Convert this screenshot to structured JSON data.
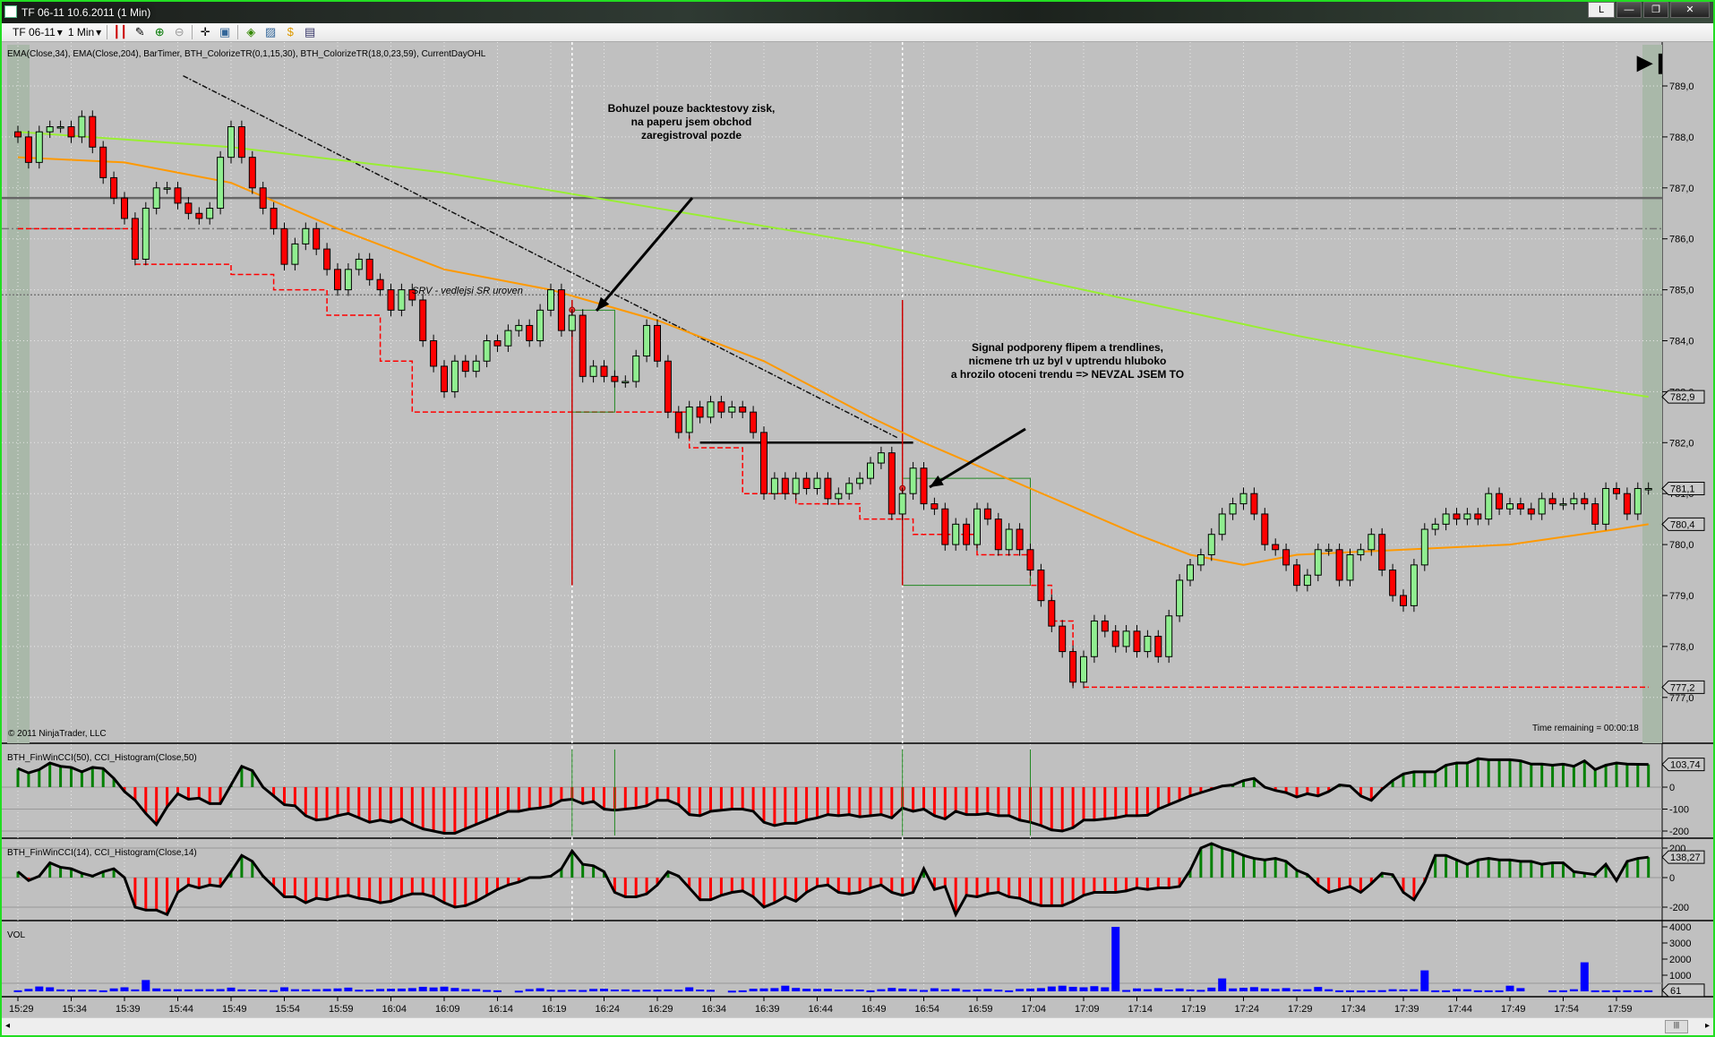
{
  "window": {
    "title": "TF 06-11  10.6.2011 (1 Min)",
    "btn_l": "L",
    "btn_min": "—",
    "btn_max": "❐",
    "btn_close": "✕"
  },
  "toolbar": {
    "instrument": "TF 06-11",
    "interval": "1 Min"
  },
  "main_panel": {
    "indicators_label": "EMA(Close,34), EMA(Close,204), BarTimer, BTH_ColorizeTR(0,1,15,30), BTH_ColorizeTR(18,0,23,59), CurrentDayOHL",
    "copyright": "© 2011 NinjaTrader, LLC",
    "time_remaining": "Time remaining = 00:00:18",
    "srv_label": "SRV - vedlejsi SR uroven",
    "note1": [
      "Bohuzel pouze backtestovy zisk,",
      "na paperu jsem obchod",
      "zaregistroval pozde"
    ],
    "note2": [
      "Signal podporeny flipem a trendlines,",
      "nicmene trh uz byl v uptrendu hluboko",
      "a hrozilo otoceni trendu => NEVZAL JSEM TO"
    ],
    "price_ticks": [
      "789,0",
      "788,0",
      "787,0",
      "786,0",
      "785,0",
      "784,0",
      "783,0",
      "782,0",
      "781,0",
      "780,0",
      "779,0",
      "778,0",
      "777,0"
    ],
    "markers": [
      {
        "label": "782,9",
        "value": 782.9
      },
      {
        "label": "781,1",
        "value": 781.1
      },
      {
        "label": "780,4",
        "value": 780.4
      },
      {
        "label": "777,2",
        "value": 777.2
      }
    ]
  },
  "cci50_panel": {
    "label": "BTH_FinWinCCI(50), CCI_Histogram(Close,50)",
    "ticks": [
      "0",
      "-100",
      "-200"
    ],
    "marker": "103,74"
  },
  "cci14_panel": {
    "label": "BTH_FinWinCCI(14), CCI_Histogram(Close,14)",
    "ticks": [
      "200",
      "0",
      "-200"
    ],
    "marker": "138,27"
  },
  "vol_panel": {
    "label": "VOL",
    "ticks": [
      "4000",
      "3000",
      "2000",
      "1000"
    ],
    "marker": "61"
  },
  "colors": {
    "bg": "#c0c0c0",
    "up": "#90ee90",
    "down": "#ff0000",
    "ema34": "#ff9900",
    "ema204": "#99ee33",
    "hist_up": "#008000",
    "hist_down": "#ff0000",
    "vol": "#0000ff"
  },
  "chart_data": {
    "type": "candlestick",
    "start_time": "15:29",
    "interval_min": 1,
    "time_labels": [
      "15:29",
      "15:34",
      "15:39",
      "15:44",
      "15:49",
      "15:54",
      "15:59",
      "16:04",
      "16:09",
      "16:14",
      "16:19",
      "16:24",
      "16:29",
      "16:34",
      "16:39",
      "16:44",
      "16:49",
      "16:54",
      "16:59",
      "17:04",
      "17:09",
      "17:14",
      "17:19",
      "17:24",
      "17:29",
      "17:34",
      "17:39",
      "17:44",
      "17:49",
      "17:54",
      "17:59"
    ],
    "ylim": [
      776.8,
      789.5
    ],
    "close": [
      788.0,
      787.5,
      788.1,
      788.2,
      788.2,
      788.0,
      788.4,
      787.8,
      787.2,
      786.8,
      786.4,
      785.6,
      786.6,
      787.0,
      787.0,
      786.7,
      786.5,
      786.4,
      786.6,
      787.6,
      788.2,
      787.6,
      787.0,
      786.6,
      786.2,
      785.5,
      785.9,
      786.2,
      785.8,
      785.4,
      785.0,
      785.4,
      785.6,
      785.2,
      785.0,
      784.6,
      785.0,
      784.8,
      784.0,
      783.5,
      783.0,
      783.6,
      783.4,
      783.6,
      784.0,
      783.9,
      784.2,
      784.3,
      784.0,
      784.6,
      785.0,
      784.2,
      784.5,
      783.3,
      783.5,
      783.3,
      783.2,
      783.2,
      783.7,
      784.3,
      783.6,
      782.6,
      782.2,
      782.7,
      782.5,
      782.8,
      782.6,
      782.7,
      782.6,
      782.2,
      781.0,
      781.3,
      781.0,
      781.3,
      781.1,
      781.3,
      780.9,
      781.0,
      781.2,
      781.3,
      781.6,
      781.8,
      780.6,
      781.0,
      781.5,
      780.8,
      780.7,
      780.0,
      780.4,
      780.0,
      780.7,
      780.5,
      779.9,
      780.3,
      779.9,
      779.5,
      778.9,
      778.4,
      777.9,
      777.3,
      777.8,
      778.5,
      778.3,
      778.0,
      778.3,
      777.9,
      778.2,
      777.8,
      778.6,
      779.3,
      779.6,
      779.8,
      780.2,
      780.6,
      780.8,
      781.0,
      780.6,
      780.0,
      779.9,
      779.6,
      779.2,
      779.4,
      779.9,
      779.9,
      779.3,
      779.8,
      779.9,
      780.2,
      779.5,
      779.0,
      778.8,
      779.6,
      780.3,
      780.4,
      780.6,
      780.5,
      780.6,
      780.5,
      781.0,
      780.7,
      780.8,
      780.7,
      780.6,
      780.9,
      780.8,
      780.8,
      780.9,
      780.8,
      780.4,
      781.1,
      781.0,
      780.6,
      781.1,
      781.1
    ],
    "ema34": [
      [
        0,
        787.6
      ],
      [
        10,
        787.5
      ],
      [
        20,
        787.1
      ],
      [
        30,
        786.2
      ],
      [
        40,
        785.4
      ],
      [
        50,
        785.0
      ],
      [
        60,
        784.4
      ],
      [
        70,
        783.6
      ],
      [
        80,
        782.5
      ],
      [
        85,
        782.0
      ],
      [
        95,
        781.1
      ],
      [
        105,
        780.2
      ],
      [
        110,
        779.8
      ],
      [
        115,
        779.6
      ],
      [
        120,
        779.8
      ],
      [
        140,
        780.0
      ],
      [
        150,
        780.3
      ],
      [
        153,
        780.4
      ]
    ],
    "ema204": [
      [
        0,
        788.1
      ],
      [
        20,
        787.8
      ],
      [
        40,
        787.3
      ],
      [
        60,
        786.6
      ],
      [
        80,
        785.9
      ],
      [
        100,
        785.0
      ],
      [
        120,
        784.1
      ],
      [
        140,
        783.3
      ],
      [
        153,
        782.9
      ]
    ],
    "levels": [
      {
        "price": 786.8,
        "style": "solid-gray"
      },
      {
        "price": 786.2,
        "style": "dashdot-gray"
      },
      {
        "price": 784.9,
        "style": "dotted-gray"
      },
      {
        "price": 786.2,
        "from": 0,
        "to": 11,
        "style": "dashed-red"
      },
      {
        "price": 777.2,
        "from": 100,
        "to": 153,
        "style": "dashed-red"
      },
      {
        "price": 782.0,
        "from": 64,
        "to": 84,
        "style": "solid-black"
      }
    ],
    "trendline": [
      [
        15.5,
        789.2
      ],
      [
        82.5,
        782.1
      ]
    ],
    "trail_stop": [
      [
        11,
        785.5
      ],
      [
        20,
        785.5
      ],
      [
        20,
        785.3
      ],
      [
        24,
        785.3
      ],
      [
        24,
        785.0
      ],
      [
        29,
        785.0
      ],
      [
        29,
        784.5
      ],
      [
        34,
        784.5
      ],
      [
        34,
        783.6
      ],
      [
        37,
        783.6
      ],
      [
        37,
        782.6
      ],
      [
        63,
        782.6
      ],
      [
        63,
        781.9
      ],
      [
        68,
        781.9
      ],
      [
        68,
        781.0
      ],
      [
        73,
        781.0
      ],
      [
        73,
        780.8
      ],
      [
        79,
        780.8
      ],
      [
        79,
        780.5
      ],
      [
        84,
        780.5
      ],
      [
        84,
        780.2
      ],
      [
        90,
        780.2
      ],
      [
        90,
        779.8
      ],
      [
        95,
        779.8
      ],
      [
        95,
        779.2
      ],
      [
        97,
        779.2
      ],
      [
        97,
        778.5
      ],
      [
        99,
        778.5
      ],
      [
        99,
        777.2
      ]
    ],
    "boxes": [
      [
        52,
        56,
        784.6,
        782.6
      ],
      [
        83,
        95,
        781.3,
        779.2
      ]
    ],
    "signal_lines": [
      52,
      83
    ],
    "cci50": [
      85,
      65,
      80,
      110,
      95,
      90,
      70,
      90,
      85,
      40,
      -20,
      -60,
      -120,
      -170,
      -90,
      -30,
      -55,
      -50,
      -75,
      -75,
      10,
      95,
      75,
      0,
      -40,
      -80,
      -85,
      -130,
      -150,
      -145,
      -130,
      -120,
      -140,
      -160,
      -150,
      -160,
      -145,
      -170,
      -190,
      -200,
      -210,
      -210,
      -190,
      -170,
      -150,
      -130,
      -110,
      -110,
      -100,
      -95,
      -85,
      -60,
      -55,
      -75,
      -65,
      -100,
      -105,
      -100,
      -95,
      -85,
      -60,
      -60,
      -80,
      -125,
      -130,
      -110,
      -105,
      -100,
      -100,
      -110,
      -160,
      -175,
      -165,
      -165,
      -150,
      -140,
      -125,
      -130,
      -125,
      -135,
      -130,
      -125,
      -140,
      -95,
      -110,
      -100,
      -130,
      -145,
      -110,
      -125,
      -125,
      -120,
      -130,
      -130,
      -150,
      -160,
      -175,
      -195,
      -200,
      -185,
      -150,
      -150,
      -145,
      -140,
      -130,
      -130,
      -128,
      -100,
      -80,
      -60,
      -40,
      -25,
      -10,
      5,
      10,
      30,
      40,
      0,
      -15,
      -25,
      -45,
      -30,
      -40,
      -20,
      10,
      5,
      -40,
      -60,
      -10,
      30,
      60,
      70,
      70,
      70,
      100,
      110,
      110,
      130,
      125,
      125,
      125,
      120,
      105,
      105,
      100,
      105,
      95,
      120,
      80,
      100,
      110,
      105,
      104,
      103.74
    ],
    "cci14": [
      40,
      -20,
      10,
      100,
      70,
      60,
      30,
      10,
      40,
      60,
      0,
      -200,
      -220,
      -220,
      -250,
      -100,
      -50,
      -70,
      -50,
      -60,
      40,
      150,
      110,
      10,
      -60,
      -130,
      -130,
      -170,
      -140,
      -150,
      -130,
      -120,
      -140,
      -150,
      -170,
      -160,
      -130,
      -110,
      -110,
      -130,
      -170,
      -200,
      -190,
      -160,
      -120,
      -80,
      -50,
      -30,
      0,
      0,
      10,
      60,
      180,
      90,
      80,
      40,
      -100,
      -130,
      -130,
      -110,
      -50,
      40,
      10,
      -70,
      -150,
      -150,
      -120,
      -100,
      -90,
      -130,
      -200,
      -170,
      -130,
      -160,
      -100,
      -60,
      -50,
      -100,
      -110,
      -100,
      -70,
      -50,
      -100,
      -120,
      -100,
      60,
      -80,
      -60,
      -250,
      -120,
      -130,
      -110,
      -100,
      -130,
      -140,
      -170,
      -190,
      -190,
      -190,
      -160,
      -120,
      -100,
      -100,
      -100,
      -90,
      -70,
      -80,
      -70,
      -70,
      -60,
      50,
      200,
      230,
      200,
      180,
      150,
      130,
      120,
      130,
      110,
      50,
      20,
      -50,
      -100,
      -80,
      -60,
      -100,
      -40,
      30,
      20,
      -100,
      -150,
      -30,
      150,
      150,
      120,
      90,
      120,
      130,
      120,
      120,
      110,
      110,
      90,
      100,
      100,
      40,
      30,
      20,
      90,
      -20,
      110,
      130,
      138.27
    ],
    "volume": [
      60,
      150,
      300,
      250,
      120,
      100,
      100,
      100,
      60,
      180,
      250,
      120,
      700,
      180,
      130,
      130,
      120,
      130,
      130,
      140,
      230,
      120,
      110,
      100,
      70,
      250,
      130,
      120,
      130,
      150,
      180,
      230,
      100,
      100,
      150,
      160,
      170,
      200,
      280,
      240,
      290,
      210,
      140,
      140,
      80,
      60,
      0,
      40,
      140,
      190,
      100,
      80,
      100,
      80,
      150,
      160,
      110,
      120,
      90,
      100,
      100,
      120,
      100,
      250,
      110,
      90,
      0,
      40,
      60,
      160,
      180,
      200,
      350,
      210,
      160,
      150,
      160,
      110,
      120,
      110,
      60,
      130,
      210,
      170,
      130,
      80,
      190,
      120,
      180,
      90,
      120,
      150,
      100,
      60,
      150,
      170,
      200,
      300,
      350,
      280,
      250,
      320,
      250,
      4000,
      80,
      180,
      130,
      200,
      110,
      180,
      120,
      90,
      230,
      800,
      180,
      220,
      260,
      180,
      150,
      200,
      120,
      130,
      270,
      130,
      60,
      60,
      50,
      60,
      70,
      130,
      120,
      130,
      1300,
      60,
      60,
      140,
      130,
      60,
      60,
      60,
      350,
      200,
      0,
      0,
      60,
      60,
      130,
      1800,
      60,
      60,
      60,
      61,
      61,
      61
    ]
  }
}
